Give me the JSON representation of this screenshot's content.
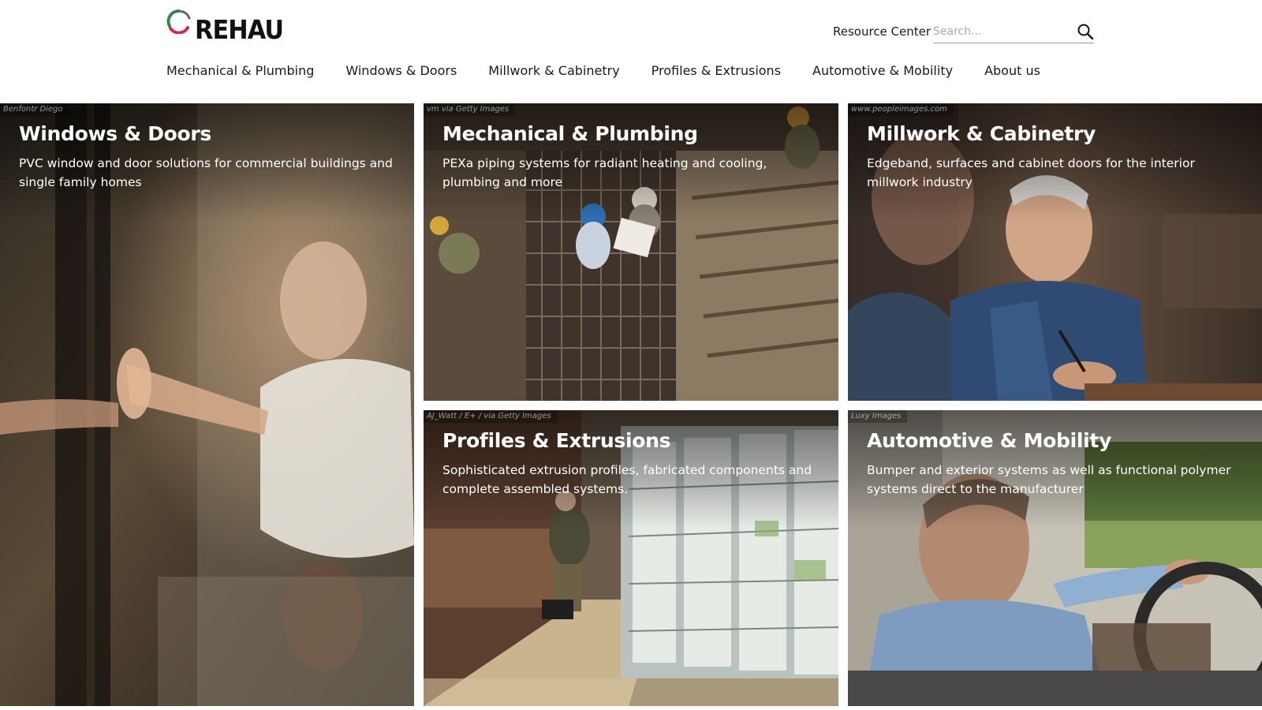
{
  "header": {
    "logo_text": "REHAU",
    "resource_center": "Resource Center",
    "search_placeholder": "Search...",
    "nav": [
      "Mechanical & Plumbing",
      "Windows & Doors",
      "Millwork & Cabinetry",
      "Profiles & Extrusions",
      "Automotive & Mobility",
      "About us"
    ]
  },
  "tiles": [
    {
      "credit": "Benfontr Diego",
      "title": "Windows & Doors",
      "desc": "PVC window and door solutions for commercial buildings and single family homes"
    },
    {
      "credit": "vm via Getty Images",
      "title": "Mechanical & Plumbing",
      "desc": "PEXa piping systems for radiant heating and cooling, plumbing and more"
    },
    {
      "credit": "www.peopleimages.com",
      "title": "Millwork & Cabinetry",
      "desc": "Edgeband, surfaces and cabinet doors for the interior millwork industry"
    },
    {
      "credit": "AJ_Watt / E+ / via Getty Images",
      "title": "Profiles & Extrusions",
      "desc": "Sophisticated extrusion profiles, fabricated components and complete assembled systems."
    },
    {
      "credit": "Luxy Images",
      "title": "Automotive & Mobility",
      "desc": "Bumper and exterior systems as well as functional polymer systems direct to the manufacturer"
    }
  ],
  "colors": {
    "logo_green": "#2f8a4a",
    "logo_red": "#d2294f",
    "text_dark": "#1a1a1a"
  }
}
